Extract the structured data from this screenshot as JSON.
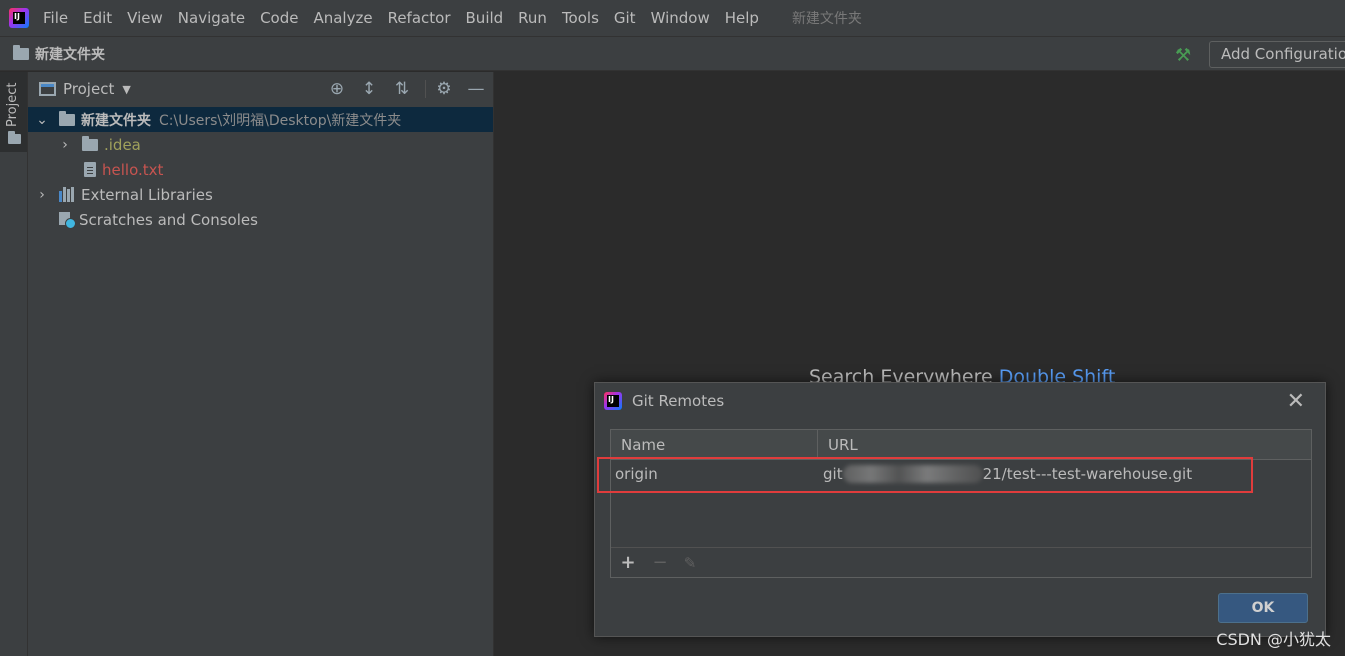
{
  "menubar": {
    "logo_text": "IJ",
    "items": [
      "File",
      "Edit",
      "View",
      "Navigate",
      "Code",
      "Analyze",
      "Refactor",
      "Build",
      "Run",
      "Tools",
      "Git",
      "Window",
      "Help"
    ],
    "project_title": "新建文件夹"
  },
  "navbar": {
    "title": "新建文件夹",
    "run_config_label": "Add Configuration..."
  },
  "sidebar": {
    "tab_label": "Project"
  },
  "project_panel": {
    "title": "Project",
    "icons": [
      "locate-icon",
      "expand-all-icon",
      "collapse-all-icon",
      "gear-icon",
      "minimize-icon"
    ],
    "tree": {
      "root": {
        "name": "新建文件夹",
        "path": "C:\\Users\\刘明福\\Desktop\\新建文件夹"
      },
      "idea": ".idea",
      "hello": "hello.txt",
      "libs": "External Libraries",
      "scratches": "Scratches and Consoles"
    }
  },
  "editor": {
    "hint_text": "Search Everywhere",
    "hint_shortcut": "Double Shift"
  },
  "dialog": {
    "title": "Git Remotes",
    "columns": {
      "name": "Name",
      "url": "URL"
    },
    "rows": [
      {
        "name": "origin",
        "url_prefix": "git",
        "url_suffix": "21/test---test-warehouse.git"
      }
    ],
    "ok_label": "OK"
  },
  "watermark": "CSDN @小犹太"
}
